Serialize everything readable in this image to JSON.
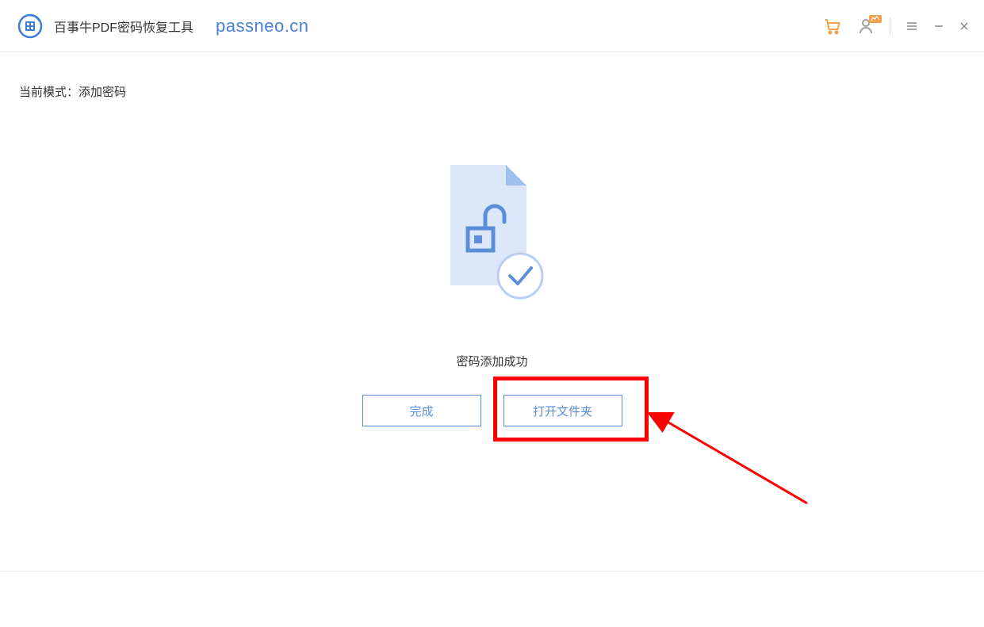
{
  "header": {
    "app_title": "百事牛PDF密码恢复工具",
    "domain": "passneo.cn"
  },
  "mode": {
    "label": "当前模式：",
    "value": "添加密码"
  },
  "status_message": "密码添加成功",
  "buttons": {
    "complete": "完成",
    "open_folder": "打开文件夹"
  },
  "colors": {
    "primary": "#5a8fd8",
    "accent": "#4a7fd8",
    "cart": "#f5a04a",
    "user_badge": "#f5a04a"
  }
}
